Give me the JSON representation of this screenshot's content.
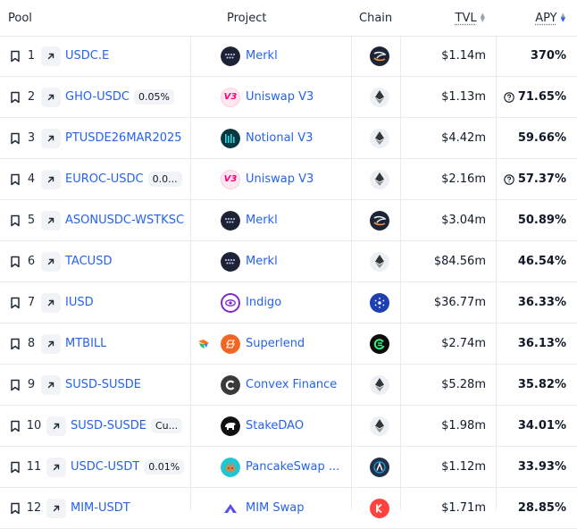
{
  "header": {
    "pool": "Pool",
    "project": "Project",
    "chain": "Chain",
    "tvl": "TVL",
    "apy": "APY"
  },
  "rows": [
    {
      "rank": "1",
      "pool": "USDC.E",
      "badge": "",
      "project": "Merkl",
      "project_icon": "merkl-icon",
      "chain_icon": "sonic-chain-icon",
      "tvl": "$1.14m",
      "apy": "370%",
      "apy_help": false,
      "partner": false
    },
    {
      "rank": "2",
      "pool": "GHO-USDC",
      "badge": "0.05%",
      "project": "Uniswap V3",
      "project_icon": "uniswap-icon",
      "chain_icon": "ethereum-chain-icon",
      "tvl": "$1.13m",
      "apy": "71.65%",
      "apy_help": true,
      "partner": false
    },
    {
      "rank": "3",
      "pool": "PTUSDE26MAR2025",
      "badge": "",
      "project": "Notional V3",
      "project_icon": "notional-icon",
      "chain_icon": "ethereum-chain-icon",
      "tvl": "$4.42m",
      "apy": "59.66%",
      "apy_help": false,
      "partner": false
    },
    {
      "rank": "4",
      "pool": "EUROC-USDC",
      "badge": "0.0...",
      "project": "Uniswap V3",
      "project_icon": "uniswap-icon",
      "chain_icon": "ethereum-chain-icon",
      "tvl": "$2.16m",
      "apy": "57.37%",
      "apy_help": true,
      "partner": false
    },
    {
      "rank": "5",
      "pool": "ASONUSDC-WSTKSC",
      "badge": "",
      "project": "Merkl",
      "project_icon": "merkl-icon",
      "chain_icon": "sonic-chain-icon",
      "tvl": "$3.04m",
      "apy": "50.89%",
      "apy_help": false,
      "partner": false
    },
    {
      "rank": "6",
      "pool": "TACUSD",
      "badge": "",
      "project": "Merkl",
      "project_icon": "merkl-icon",
      "chain_icon": "ethereum-chain-icon",
      "tvl": "$84.56m",
      "apy": "46.54%",
      "apy_help": false,
      "partner": false
    },
    {
      "rank": "7",
      "pool": "IUSD",
      "badge": "",
      "project": "Indigo",
      "project_icon": "indigo-icon",
      "chain_icon": "cardano-chain-icon",
      "tvl": "$36.77m",
      "apy": "36.33%",
      "apy_help": false,
      "partner": false
    },
    {
      "rank": "8",
      "pool": "MTBILL",
      "badge": "",
      "project": "Superlend",
      "project_icon": "superlend-icon",
      "chain_icon": "etherlink-chain-icon",
      "tvl": "$2.74m",
      "apy": "36.13%",
      "apy_help": false,
      "partner": true
    },
    {
      "rank": "9",
      "pool": "SUSD-SUSDE",
      "badge": "",
      "project": "Convex Finance",
      "project_icon": "convex-icon",
      "chain_icon": "ethereum-chain-icon",
      "tvl": "$5.28m",
      "apy": "35.82%",
      "apy_help": false,
      "partner": false
    },
    {
      "rank": "10",
      "pool": "SUSD-SUSDE",
      "badge": "Cu...",
      "project": "StakeDAO",
      "project_icon": "stakedao-icon",
      "chain_icon": "ethereum-chain-icon",
      "tvl": "$1.98m",
      "apy": "34.01%",
      "apy_help": false,
      "partner": false
    },
    {
      "rank": "11",
      "pool": "USDC-USDT",
      "badge": "0.01%",
      "project": "PancakeSwap ...",
      "project_icon": "pancakeswap-icon",
      "chain_icon": "arbitrum-chain-icon",
      "tvl": "$1.12m",
      "apy": "33.93%",
      "apy_help": false,
      "partner": false
    },
    {
      "rank": "12",
      "pool": "MIM-USDT",
      "badge": "",
      "project": "MIM Swap",
      "project_icon": "mimswap-icon",
      "chain_icon": "kava-chain-icon",
      "tvl": "$1.71m",
      "apy": "28.85%",
      "apy_help": false,
      "partner": false
    }
  ],
  "colors": {
    "link": "#2563eb",
    "sort_active": "#2563eb",
    "grid": "#e8eaee"
  }
}
